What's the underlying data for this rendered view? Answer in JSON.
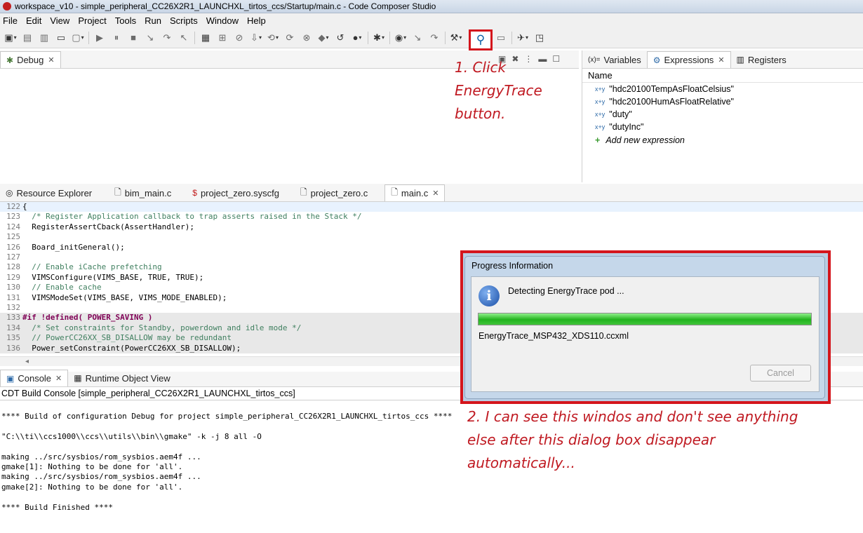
{
  "window": {
    "title": "workspace_v10 - simple_peripheral_CC26X2R1_LAUNCHXL_tirtos_ccs/Startup/main.c - Code Composer Studio"
  },
  "menu": [
    "File",
    "Edit",
    "View",
    "Project",
    "Tools",
    "Run",
    "Scripts",
    "Window",
    "Help"
  ],
  "debug_panel": {
    "tab_label": "Debug"
  },
  "vars_panel": {
    "tabs": [
      "Variables",
      "Expressions",
      "Registers"
    ],
    "column_name": "Name",
    "expressions": [
      "\"hdc20100TempAsFloatCelsius\"",
      "\"hdc20100HumAsFloatRelative\"",
      "\"duty\"",
      "\"dutyInc\""
    ],
    "add_new": "Add new expression"
  },
  "annotation1": {
    "line1": "1. Click",
    "line2": "EnergyTrace",
    "line3": "button."
  },
  "editor_tabs": [
    "Resource Explorer",
    "bim_main.c",
    "project_zero.syscfg",
    "project_zero.c",
    "main.c"
  ],
  "code_lines": [
    {
      "n": "122",
      "text": "{"
    },
    {
      "n": "123",
      "text": "  /* Register Application callback to trap asserts raised in the Stack */"
    },
    {
      "n": "124",
      "text": "  RegisterAssertCback(AssertHandler);"
    },
    {
      "n": "125",
      "text": ""
    },
    {
      "n": "126",
      "text": "  Board_initGeneral();"
    },
    {
      "n": "127",
      "text": ""
    },
    {
      "n": "128",
      "text": "  // Enable iCache prefetching"
    },
    {
      "n": "129",
      "text": "  VIMSConfigure(VIMS_BASE, TRUE, TRUE);"
    },
    {
      "n": "130",
      "text": "  // Enable cache"
    },
    {
      "n": "131",
      "text": "  VIMSModeSet(VIMS_BASE, VIMS_MODE_ENABLED);"
    },
    {
      "n": "132",
      "text": ""
    },
    {
      "n": "133",
      "text": "#if !defined( POWER_SAVING )"
    },
    {
      "n": "134",
      "text": "  /* Set constraints for Standby, powerdown and idle mode */"
    },
    {
      "n": "135",
      "text": "  // PowerCC26XX_SB_DISALLOW may be redundant"
    },
    {
      "n": "136",
      "text": "  Power_setConstraint(PowerCC26XX_SB_DISALLOW);"
    }
  ],
  "console": {
    "tabs": [
      "Console",
      "Runtime Object View"
    ],
    "title": "CDT Build Console [simple_peripheral_CC26X2R1_LAUNCHXL_tirtos_ccs]",
    "lines": [
      "**** Build of configuration Debug for project simple_peripheral_CC26X2R1_LAUNCHXL_tirtos_ccs ****",
      "",
      "\"C:\\\\ti\\\\ccs1000\\\\ccs\\\\utils\\\\bin\\\\gmake\" -k -j 8 all -O",
      "",
      "making ../src/sysbios/rom_sysbios.aem4f ...",
      "gmake[1]: Nothing to be done for 'all'.",
      "making ../src/sysbios/rom_sysbios.aem4f ...",
      "gmake[2]: Nothing to be done for 'all'.",
      "",
      "**** Build Finished ****"
    ]
  },
  "dialog": {
    "title": "Progress Information",
    "message": "Detecting EnergyTrace pod ...",
    "progress": 1.0,
    "file": "EnergyTrace_MSP432_XDS110.ccxml",
    "cancel_label": "Cancel"
  },
  "annotation2": {
    "line1": "2. I can see this windos and don't see anything",
    "line2": "else after this dialog box disappear",
    "line3": "automatically..."
  },
  "colors": {
    "annotation": "#d4151c",
    "progress": "#22b31e"
  }
}
